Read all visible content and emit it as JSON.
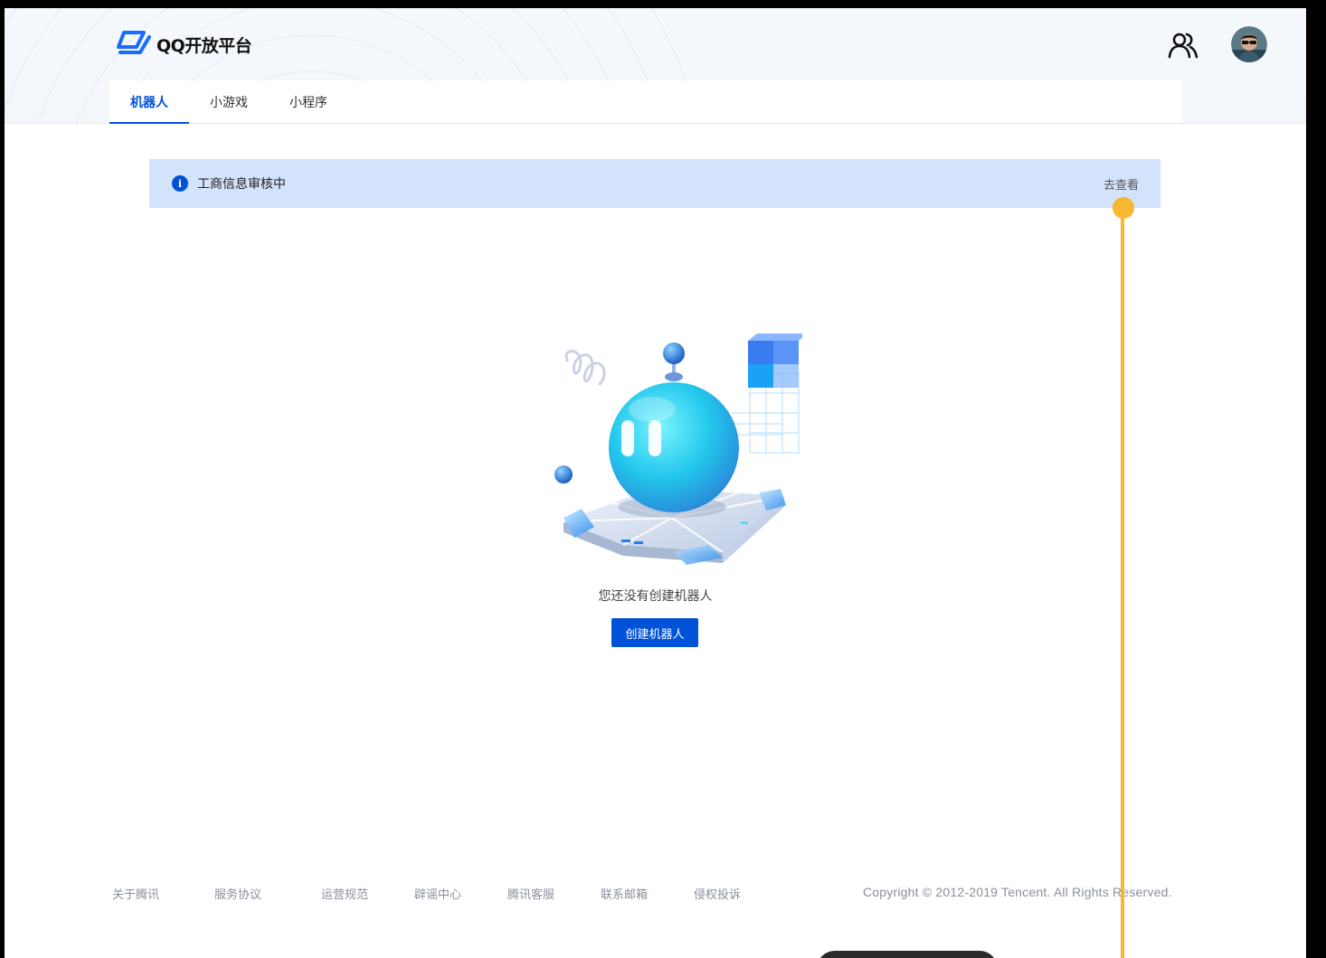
{
  "brand": {
    "logo_text": "QQ开放平台",
    "accent_color": "#0052d9"
  },
  "header": {
    "users_icon": "users-icon",
    "avatar": "user-avatar"
  },
  "tabs": [
    {
      "label": "机器人",
      "active": true
    },
    {
      "label": "小游戏",
      "active": false
    },
    {
      "label": "小程序",
      "active": false
    }
  ],
  "notice": {
    "icon": "info-icon",
    "icon_glyph": "i",
    "text": "工商信息审核中",
    "link": "去查看",
    "background": "#d4e3fc"
  },
  "empty_state": {
    "illustration": "robot-illustration",
    "message": "您还没有创建机器人",
    "button_label": "创建机器人"
  },
  "footer": {
    "links": [
      "关于腾讯",
      "服务协议",
      "运营规范",
      "辟谣中心",
      "腾讯客服",
      "联系邮箱",
      "侵权投诉"
    ],
    "copyright": "Copyright © 2012-2019 Tencent. All Rights Reserved."
  },
  "annotation": {
    "color": "#f7b731"
  }
}
